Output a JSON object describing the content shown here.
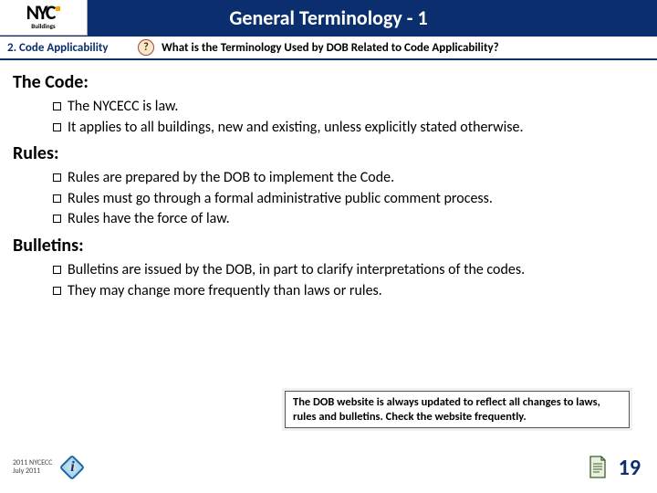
{
  "logo": {
    "text": "NYC",
    "sub": "Buildings"
  },
  "title": "General Terminology - 1",
  "crumb": "2. Code Applicability",
  "qmark": "?",
  "question": "What is the Terminology Used by DOB Related to Code Applicability?",
  "sections": {
    "code": {
      "heading": "The Code:",
      "items": [
        "The NYCECC is law.",
        "It applies to all buildings, new and existing, unless explicitly stated otherwise."
      ]
    },
    "rules": {
      "heading": "Rules:",
      "items": [
        "Rules are prepared by the DOB to implement the Code.",
        "Rules must go through a formal administrative public comment process.",
        "Rules have the force of law."
      ]
    },
    "bulletins": {
      "heading": "Bulletins:",
      "items": [
        "Bulletins are issued by the DOB, in part to clarify interpretations of the codes.",
        "They may change more frequently than laws or rules."
      ]
    }
  },
  "note": "The DOB website is always updated to reflect all changes to laws, rules and bulletins.  Check the website frequently.",
  "footer": {
    "line1": "2011 NYCECC",
    "line2": "July 2011",
    "page": "19"
  }
}
